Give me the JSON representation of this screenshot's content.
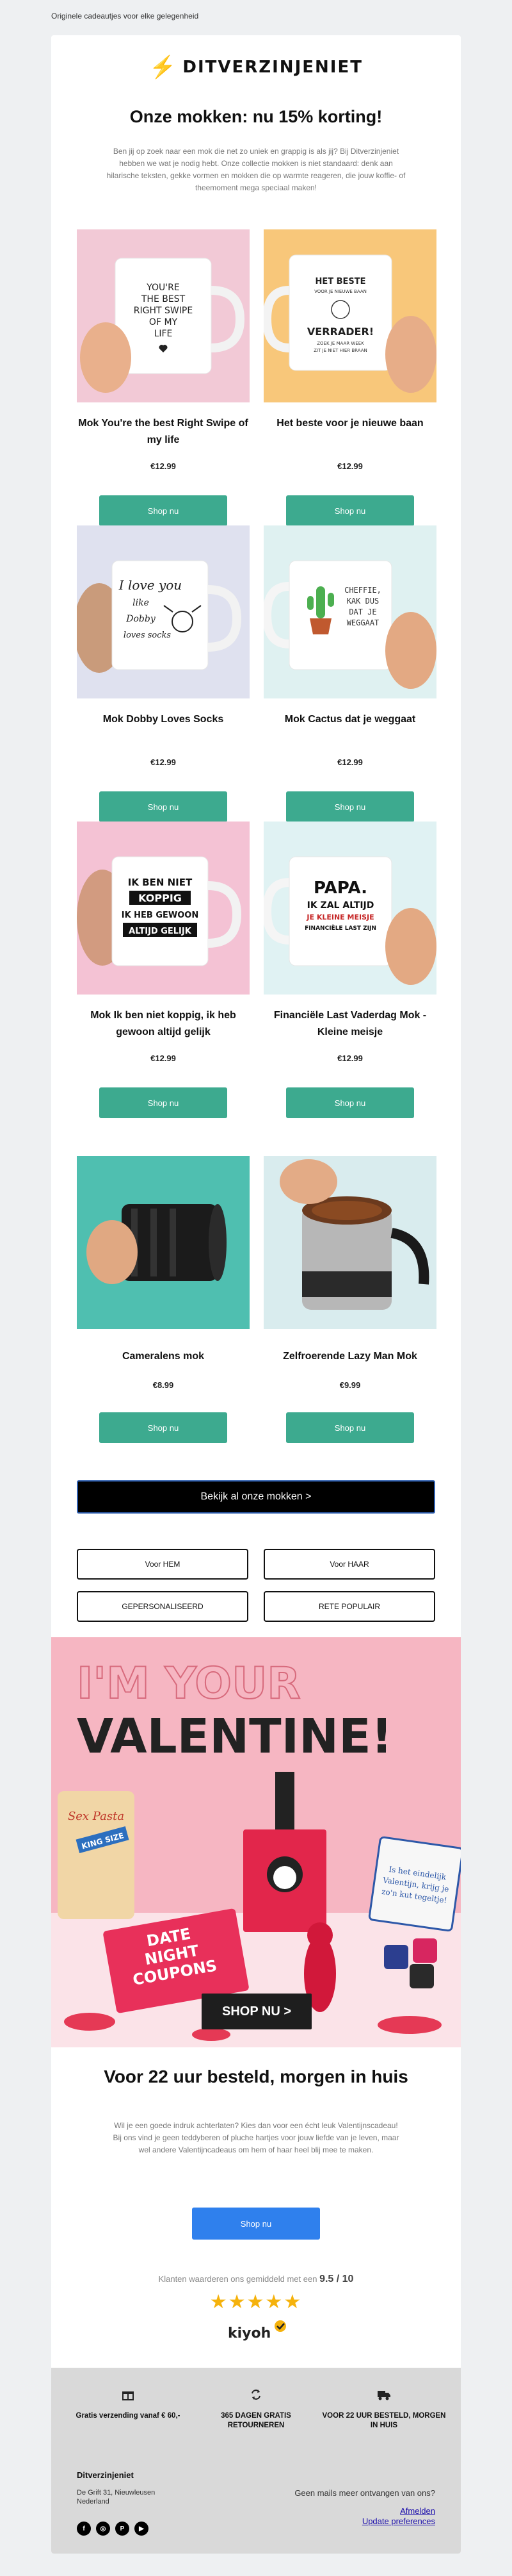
{
  "preheader": "Originele cadeautjes voor elke gelegenheid",
  "brand": {
    "logo_text": "DITVERZINJENIET",
    "logo_symbol": "⚡"
  },
  "headline": "Onze mokken: nu 15% korting!",
  "intro": "Ben jij op zoek naar een mok die net zo uniek en grappig is als jij? Bij Ditverzinjeniet hebben we wat je nodig hebt. Onze collectie mokken is niet standaard: denk aan hilarische teksten, gekke vormen en mokken die op warmte reageren, die jouw koffie- of theemoment mega speciaal maken!",
  "products": [
    {
      "name": "Mok You're the best Right Swipe of my life",
      "price": "€12.99",
      "button": "Shop nu",
      "mug_text": [
        "YOU'RE",
        "THE BEST",
        "RIGHT SWIPE",
        "OF MY",
        "LIFE"
      ]
    },
    {
      "name": "Het beste voor je nieuwe baan",
      "price": "€12.99",
      "button": "Shop nu",
      "mug_text": [
        "HET BESTE",
        "VOOR JE NIEUWE BAAN",
        "VERRADER!",
        "ZOEK JE MAAR WEEK",
        "ZIT JE NIET HIER BRAAN"
      ]
    },
    {
      "name": "Mok Dobby Loves Socks",
      "price": "€12.99",
      "button": "Shop nu",
      "mug_text": [
        "I love you",
        "like",
        "Dobby",
        "loves socks"
      ]
    },
    {
      "name": "Mok Cactus dat je weggaat",
      "price": "€12.99",
      "button": "Shop nu",
      "mug_text": [
        "CHEFFIE,",
        "KAK DUS",
        "DAT JE",
        "WEGGAAT"
      ]
    },
    {
      "name": "Mok Ik ben niet koppig, ik heb gewoon altijd gelijk",
      "price": "€12.99",
      "button": "Shop nu",
      "mug_text": [
        "IK BEN NIET",
        "KOPPIG",
        "IK HEB GEWOON",
        "ALTIJD GELIJK"
      ]
    },
    {
      "name": "Financiële Last Vaderdag Mok - Kleine meisje",
      "price": "€12.99",
      "button": "Shop nu",
      "mug_text": [
        "PAPA.",
        "IK ZAL ALTIJD",
        "JE KLEINE MEISJE",
        "FINANCIËLE LAST ZIJN"
      ]
    },
    {
      "name": "Cameralens mok",
      "price": "€8.99",
      "button": "Shop nu"
    },
    {
      "name": "Zelfroerende Lazy Man Mok",
      "price": "€9.99",
      "button": "Shop nu"
    }
  ],
  "all_button": "Bekijk al onze mokken >",
  "categories": [
    "Voor HEM",
    "Voor HAAR",
    "GEPERSONALISEERD",
    "RETE POPULAIR"
  ],
  "banner": {
    "line1": "I'M YOUR",
    "line2": "VALENTINE!",
    "bubble": [
      "Is het eindelijk",
      "Valentijn, krijg je",
      "zo'n kut tegeltje!"
    ],
    "coupons": [
      "DATE",
      "NIGHT",
      "COUPONS"
    ],
    "pasta": [
      "Sex Pasta",
      "KING SIZE"
    ],
    "cta": "SHOP NU >"
  },
  "section2": {
    "title": "Voor 22 uur besteld, morgen in huis",
    "text": "Wil je een goede indruk achterlaten? Kies dan voor een écht leuk Valentijnscadeau! Bij ons vind je geen teddyberen of pluche hartjes voor jouw liefde van je leven, maar wel andere Valentijncadeaus om hem of haar heel blij mee te maken.",
    "button": "Shop nu"
  },
  "rating": {
    "prefix": "Klanten waarderen ons gemiddeld met een",
    "score": "9.5 / 10",
    "stars": 5,
    "brand": "kiyoh"
  },
  "footer": {
    "usps": [
      {
        "icon": "gift-icon",
        "text": "Gratis verzending vanaf € 60,-"
      },
      {
        "icon": "return-icon",
        "text": "365 DAGEN GRATIS RETOURNEREN"
      },
      {
        "icon": "truck-icon",
        "text": "VOOR 22 UUR BESTELD, MORGEN IN HUIS"
      }
    ],
    "company": "Ditverzinjeniet",
    "address": "De Grift 31, Nieuwleusen Nederland",
    "unsubscribe_question": "Geen mails meer ontvangen van ons?",
    "unsubscribe_link": "Afmelden",
    "preferences_link": "Update preferences"
  },
  "colors": {
    "accent": "#3daa8f",
    "brand_red": "#e4412b",
    "blue": "#2f80ed",
    "banner_pink": "#f6b6c2"
  }
}
